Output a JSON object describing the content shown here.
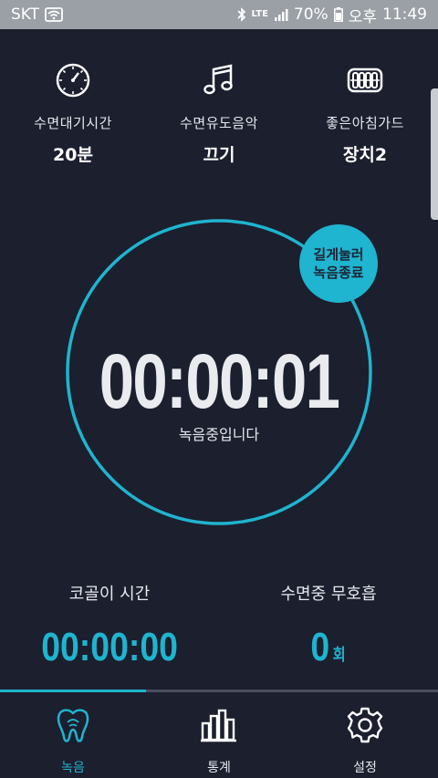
{
  "status_bar": {
    "carrier": "SKT",
    "network": "LTE",
    "battery": "70%",
    "ampm": "오후",
    "time": "11:49"
  },
  "settings": [
    {
      "label": "수면대기시간",
      "value": "20분",
      "icon": "stopwatch-icon"
    },
    {
      "label": "수면유도음악",
      "value": "끄기",
      "icon": "music-note-icon"
    },
    {
      "label": "좋은아침가드",
      "value": "장치2",
      "icon": "mouthguard-icon"
    }
  ],
  "recording": {
    "timer": "00:00:01",
    "status": "녹음중입니다",
    "stop_line1": "길게눌러",
    "stop_line2": "녹음종료"
  },
  "stats": {
    "snoring_label": "코골이 시간",
    "snoring_value": "00:00:00",
    "apnea_label": "수면중 무호흡",
    "apnea_value": "0",
    "apnea_unit": "회"
  },
  "nav": [
    {
      "label": "녹음",
      "icon": "tooth-icon",
      "active": true
    },
    {
      "label": "통계",
      "icon": "bar-chart-icon",
      "active": false
    },
    {
      "label": "설정",
      "icon": "gear-icon",
      "active": false
    }
  ],
  "colors": {
    "background": "#1c1f2e",
    "accent": "#1fb4cf",
    "status_bar": "#9aa0a6"
  }
}
